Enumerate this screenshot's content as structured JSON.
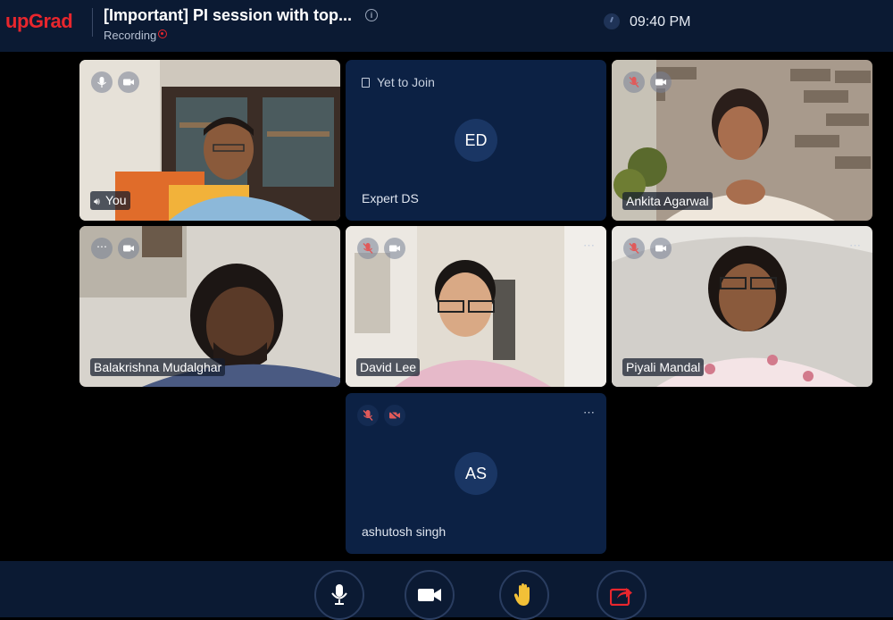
{
  "header": {
    "logo": "upGrad",
    "title": "[Important] PI session with top...",
    "info_icon": "info-icon",
    "recording_label": "Recording",
    "time": "09:40 PM"
  },
  "tiles": [
    {
      "name": "You",
      "mic": "mic-on",
      "camera": "camera-on",
      "type": "video"
    },
    {
      "name": "Expert DS",
      "status": "Yet to Join",
      "initials": "ED",
      "type": "empty"
    },
    {
      "name": "Ankita Agarwal",
      "mic": "mic-muted",
      "camera": "camera-on",
      "type": "video"
    },
    {
      "name": "Balakrishna Mudalghar",
      "mic": "more",
      "camera": "camera-on",
      "type": "video"
    },
    {
      "name": "David Lee",
      "mic": "mic-muted",
      "camera": "camera-on",
      "type": "video"
    },
    {
      "name": "Piyali Mandal",
      "mic": "mic-muted",
      "camera": "camera-on",
      "type": "video"
    },
    {
      "name": "ashutosh singh",
      "initials": "AS",
      "mic": "mic-muted",
      "camera": "camera-off",
      "type": "empty"
    }
  ],
  "more_icon": "⋯",
  "controls": [
    "microphone-icon",
    "camera-icon",
    "raise-hand-icon",
    "share-screen-icon"
  ],
  "colors": {
    "brand": "#e8262d",
    "header_bg": "#0b1a33",
    "tile_empty_bg": "#0c2144",
    "muted_red": "#e05a5a"
  }
}
